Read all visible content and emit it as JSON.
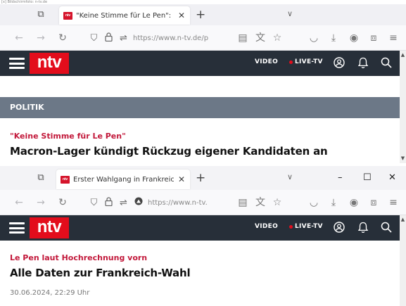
{
  "caption": "[x] Bildschirmfoto: n-tv.de",
  "windows": [
    {
      "tab": {
        "favicon_text": "ntv",
        "title": "\"Keine Stimme für Le Pen\": Ma",
        "close": "✕"
      },
      "url": "https://www.n-tv.de/p",
      "header": {
        "logo": "ntv",
        "video": "VIDEO",
        "live": "LIVE-TV"
      },
      "section": "POLITIK",
      "kicker": "\"Keine Stimme für Le Pen\"",
      "headline": "Macron-Lager kündigt Rückzug eigener Kandidaten an"
    },
    {
      "tab": {
        "favicon_text": "ntv",
        "title": "Erster Wahlgang in Frankreich:",
        "close": "✕"
      },
      "url": "https://www.n-tv.",
      "header": {
        "logo": "ntv",
        "video": "VIDEO",
        "live": "LIVE-TV"
      },
      "kicker": "Le Pen laut Hochrechnung vorn",
      "headline": "Alle Daten zur Frankreich-Wahl",
      "date": "30.06.2024, 22:29 Uhr"
    }
  ],
  "icons": {
    "tab_list": "⧉",
    "new_tab": "+",
    "overflow": "∨",
    "minimize": "–",
    "maximize": "☐",
    "close": "✕",
    "back": "←",
    "forward": "→",
    "reload": "↻",
    "shield": "⛉",
    "lock": "🔒",
    "permissions": "⇌",
    "reader": "▤",
    "translate": "文",
    "bookmark": "☆",
    "pocket": "◡",
    "download": "⤓",
    "account": "◉",
    "extensions": "⧈",
    "menu": "≡"
  },
  "colors": {
    "brand_red": "#e30d1c",
    "header_bg": "#272f39",
    "section_bg": "#6c7887",
    "kicker": "#c2183a"
  }
}
